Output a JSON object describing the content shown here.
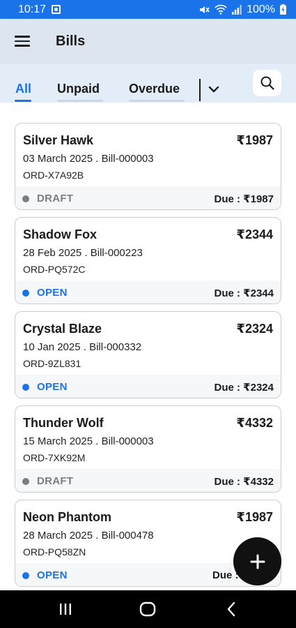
{
  "status_bar": {
    "time": "10:17",
    "battery": "100%"
  },
  "app_bar": {
    "title": "Bills",
    "menu_icon": "hamburger-menu-icon"
  },
  "tabs": [
    {
      "label": "All",
      "active": true
    },
    {
      "label": "Unpaid",
      "active": false
    },
    {
      "label": "Overdue",
      "active": false
    }
  ],
  "colors": {
    "accent": "#1a73e8",
    "draft": "#7d7d7d",
    "open": "#1a73e8",
    "app_bar_bg": "#dde6f0",
    "tabs_bg": "#e3edf8"
  },
  "bills": [
    {
      "name": "Silver Hawk",
      "amount": "₹1987",
      "meta": "03 March 2025 . Bill-000003",
      "order": "ORD-X7A92B",
      "status": "DRAFT",
      "due": "Due : ₹1987"
    },
    {
      "name": "Shadow Fox",
      "amount": "₹2344",
      "meta": "28 Feb 2025 . Bill-000223",
      "order": "ORD-PQ572C",
      "status": "OPEN",
      "due": "Due : ₹2344"
    },
    {
      "name": "Crystal Blaze",
      "amount": "₹2324",
      "meta": "10 Jan 2025 . Bill-000332",
      "order": "ORD-9ZL831",
      "status": "OPEN",
      "due": "Due : ₹2324"
    },
    {
      "name": "Thunder Wolf",
      "amount": "₹4332",
      "meta": "15 March 2025 . Bill-000003",
      "order": "ORD-7XK92M",
      "status": "DRAFT",
      "due": "Due : ₹4332"
    },
    {
      "name": "Neon Phantom",
      "amount": "₹1987",
      "meta": "28 March 2025 . Bill-000478",
      "order": "ORD-PQ58ZN",
      "status": "OPEN",
      "due": "Due :"
    }
  ],
  "fab": {
    "icon": "plus-icon"
  }
}
